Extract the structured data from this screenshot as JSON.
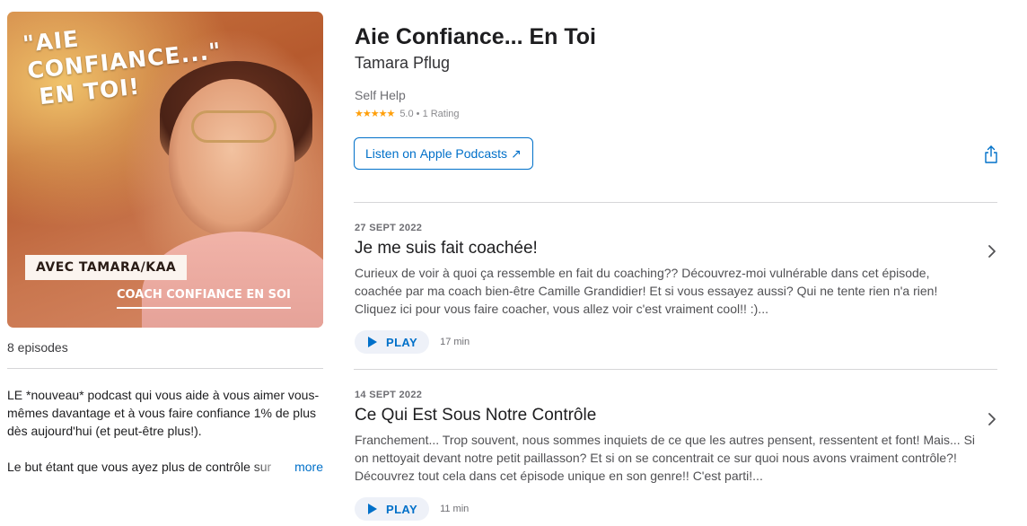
{
  "podcast": {
    "artwork": {
      "title_lines": [
        "\"AIE",
        "CONFIANCE...\"",
        "EN TOI!"
      ],
      "badge": "AVEC TAMARA/KAA",
      "subtitle": "COACH CONFIANCE EN SOI"
    },
    "title": "Aie Confiance... En Toi",
    "author": "Tamara Pflug",
    "category": "Self Help",
    "rating": {
      "stars": "★★★★★",
      "text": "5.0 • 1 Rating",
      "value": 5.0
    },
    "listen_button": {
      "prefix": "Listen on",
      "label": "Apple Podcasts",
      "arrow": "↗"
    },
    "share_icon": "share-icon",
    "episode_count": "8 episodes",
    "description": {
      "paragraph1": "LE *nouveau* podcast qui vous aide à vous aimer vous-mêmes davantage et à vous faire confiance 1% de plus dès aujourd'hui (et peut-être plus!).",
      "paragraph2": "Le but étant que vous ayez plus de contrôle sur",
      "more": "more"
    }
  },
  "episodes": [
    {
      "date": "27 SEPT 2022",
      "title": "Je me suis fait coachée!",
      "description": "Curieux de voir à quoi ça ressemble en fait du coaching?? Découvrez-moi vulnérable dans cet épisode, coachée par ma coach bien-être Camille Grandidier! Et si vous essayez aussi? Qui ne tente rien n'a rien! Cliquez ici pour vous faire coacher, vous allez voir c'est vraiment cool!! :)...",
      "play_label": "PLAY",
      "duration": "17 min"
    },
    {
      "date": "14 SEPT 2022",
      "title": "Ce Qui Est Sous Notre Contrôle",
      "description": "Franchement... Trop souvent, nous sommes inquiets de ce que les autres pensent, ressentent et font! Mais... Si on nettoyait devant notre petit paillasson? Et si on se concentrait ce sur quoi nous avons vraiment contrôle?! Découvrez tout cela dans cet épisode unique en son genre!! C'est parti!...",
      "play_label": "PLAY",
      "duration": "11 min"
    }
  ],
  "colors": {
    "accent": "#0070c9",
    "star": "#ff9f0a",
    "divider": "#d6d6d8"
  }
}
